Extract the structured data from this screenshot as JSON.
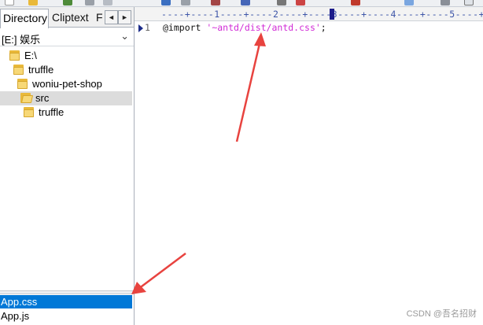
{
  "tabs": {
    "directory": "Directory",
    "cliptext": "Cliptext",
    "third_partial": "F",
    "scroll_left": "◄",
    "scroll_right": "►"
  },
  "drive": {
    "label": "[E:] 娱乐",
    "chevron": "⌄"
  },
  "tree": [
    {
      "label": "E:\\",
      "icon": "folder-icon"
    },
    {
      "label": "truffle",
      "icon": "folder-icon"
    },
    {
      "label": "woniu-pet-shop",
      "icon": "folder-icon"
    },
    {
      "label": "src",
      "icon": "open-folder-icon",
      "selected": true
    },
    {
      "label": "truffle",
      "icon": "folder-icon"
    }
  ],
  "files": [
    {
      "label": "App.css",
      "selected": true
    },
    {
      "label": "App.js",
      "selected": false
    }
  ],
  "editor": {
    "ruler": "----+----1----+----2----+----3----+----4----+----5----+-",
    "line_number": "1",
    "code_keyword": "@import ",
    "code_string": "'~antd/dist/antd.css'",
    "code_end": ";"
  },
  "colors": {
    "annotation_arrow": "#e8433f",
    "selection": "#0078d7",
    "string": "#d12bd6"
  },
  "watermark": "CSDN @吾名招财"
}
